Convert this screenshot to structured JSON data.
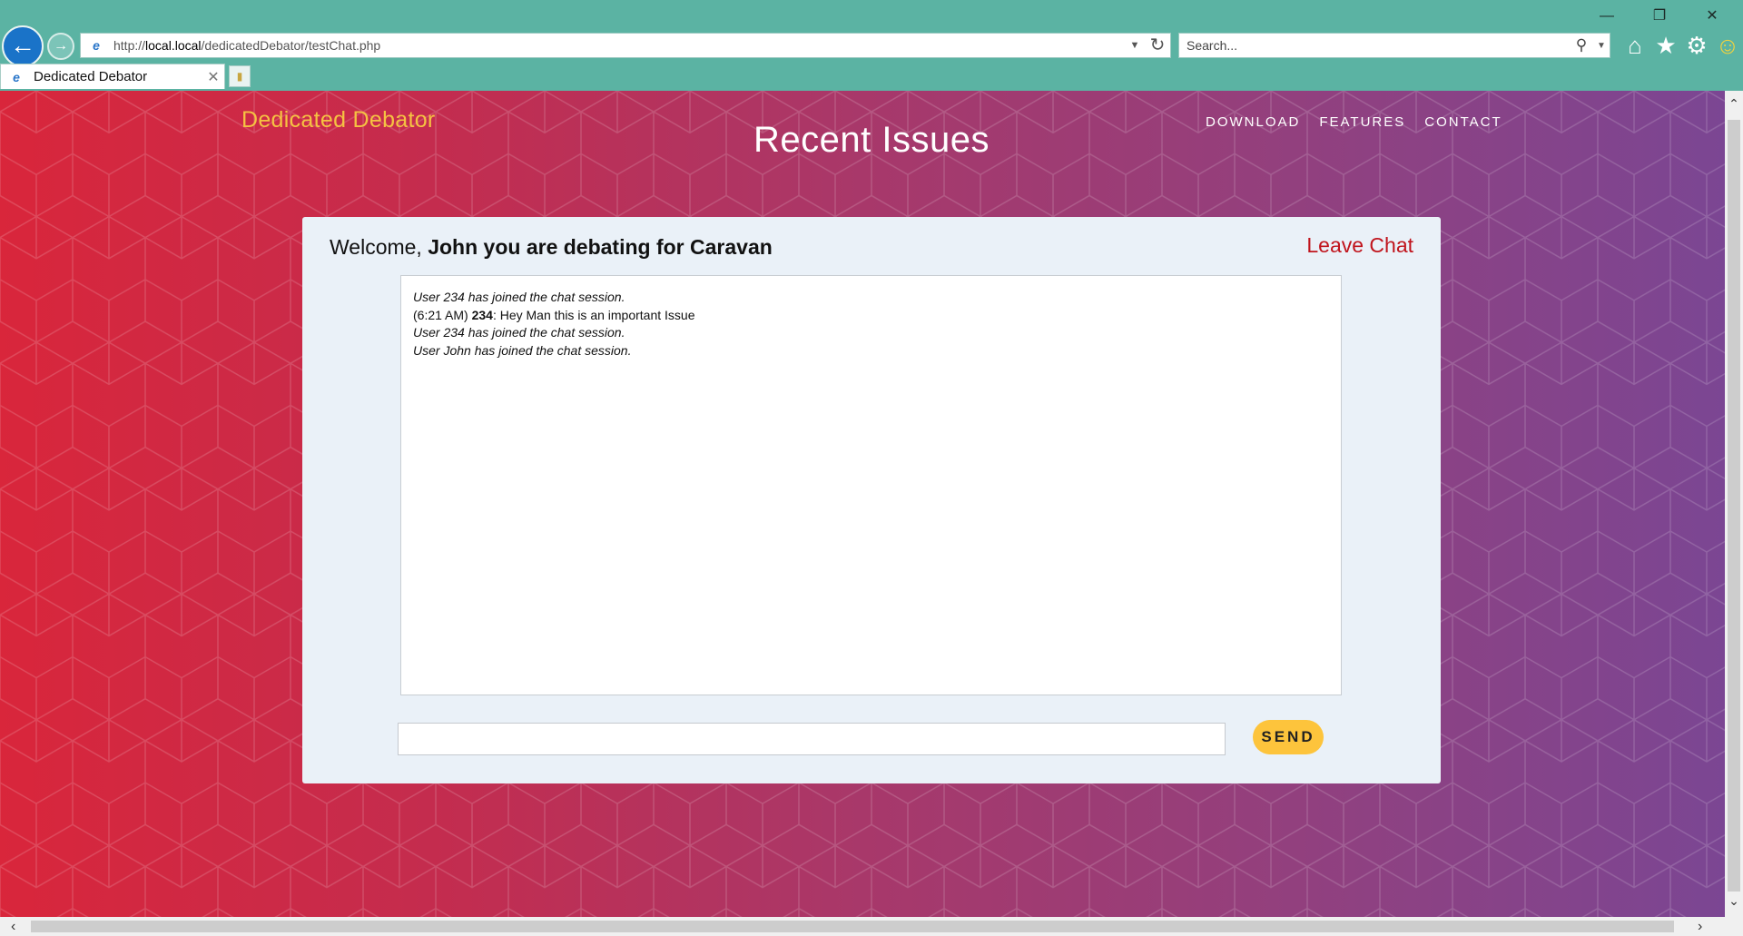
{
  "browser": {
    "address_url_prefix": "http://",
    "address_url_host": "local.local",
    "address_url_path": "/dedicatedDebator/testChat.php",
    "search_placeholder": "Search...",
    "tab_title": "Dedicated Debator",
    "icons": [
      "back-arrow-icon",
      "forward-arrow-icon",
      "refresh-icon",
      "search-icon",
      "home-icon",
      "favorites-star-icon",
      "settings-gear-icon",
      "feedback-smiley-icon"
    ]
  },
  "site": {
    "brand": "Dedicated Debator",
    "heading": "Recent Issues",
    "nav": [
      "DOWNLOAD",
      "FEATURES",
      "CONTACT"
    ]
  },
  "chat": {
    "welcome_prefix": "Welcome, ",
    "welcome_bold": "John you are debating for Caravan",
    "leave_label": "Leave Chat",
    "messages": [
      {
        "type": "system",
        "text": "User 234 has joined the chat session."
      },
      {
        "type": "message",
        "time": "(6:21 AM) ",
        "author": "234",
        "text": ": Hey Man this is an important Issue"
      },
      {
        "type": "system",
        "text": "User 234 has joined the chat session."
      },
      {
        "type": "system",
        "text": "User John has joined the chat session."
      }
    ],
    "input_value": "",
    "send_label": "SEND"
  },
  "colors": {
    "chrome": "#5bb3a3",
    "gradient_start": "#d9263b",
    "gradient_end": "#7b4693",
    "brand": "#f5c242",
    "leave_chat": "#c0141c",
    "send_button": "#fdc43c"
  }
}
